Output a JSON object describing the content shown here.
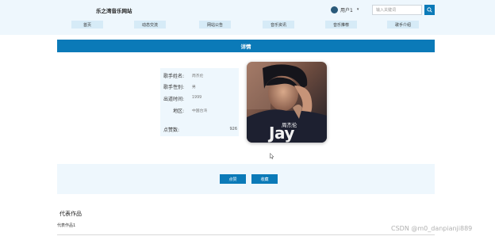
{
  "header": {
    "site_title": "乐之湾音乐网站",
    "user_label": "用户1",
    "caret": "▾",
    "search_placeholder": "输入关键词"
  },
  "nav": {
    "items": [
      {
        "label": "首页"
      },
      {
        "label": "动态交流"
      },
      {
        "label": "网站公告"
      },
      {
        "label": "音乐资讯"
      },
      {
        "label": "音乐推荐"
      },
      {
        "label": "歌手介绍"
      }
    ]
  },
  "detail": {
    "title": "详情",
    "fields": [
      {
        "label": "歌手姓名:",
        "value": "周杰伦"
      },
      {
        "label": "歌手性别:",
        "value": "男"
      },
      {
        "label": "出道时间:",
        "value": "1999"
      },
      {
        "label": "地区:",
        "value": "中国台湾"
      }
    ],
    "likes_label": "点赞数:",
    "likes_value": "926",
    "cover_text": "Jay",
    "cover_name": "周杰伦"
  },
  "actions": {
    "like_label": "点赞",
    "favorite_label": "收藏"
  },
  "works": {
    "title": "代表作品",
    "items": [
      "代表作品1"
    ]
  },
  "watermark": "CSDN @m0_danpianji889",
  "colors": {
    "accent": "#0b7ab8",
    "header_bg": "#eef7fd",
    "nav_item_bg": "#d6ebf7"
  },
  "icons": {
    "search": "search-icon",
    "avatar": "avatar",
    "cursor": "cursor-icon"
  }
}
